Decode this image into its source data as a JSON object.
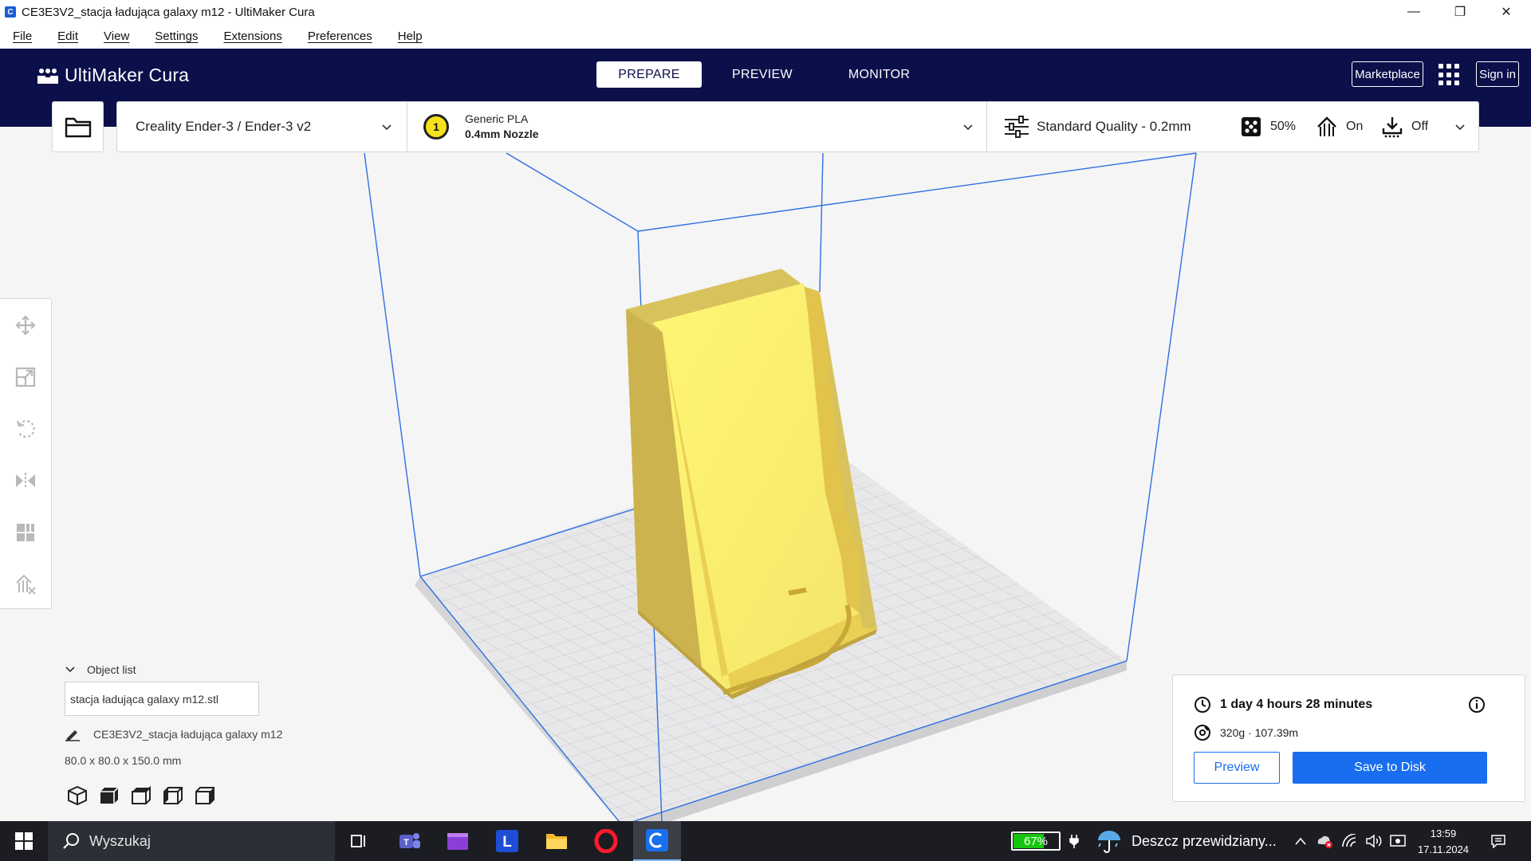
{
  "window": {
    "title": "CE3E3V2_stacja ładująca galaxy m12 - UltiMaker Cura",
    "minimize": "—",
    "restore": "❐",
    "close": "✕"
  },
  "menu": [
    "File",
    "Edit",
    "View",
    "Settings",
    "Extensions",
    "Preferences",
    "Help"
  ],
  "header": {
    "logo_text": "UltiMaker Cura",
    "tabs": [
      {
        "label": "PREPARE",
        "active": true
      },
      {
        "label": "PREVIEW",
        "active": false
      },
      {
        "label": "MONITOR",
        "active": false
      }
    ],
    "marketplace": "Marketplace",
    "signin": "Sign in"
  },
  "toolbar": {
    "printer": "Creality Ender-3 / Ender-3 v2",
    "extruder_number": "1",
    "material": "Generic PLA",
    "nozzle": "0.4mm Nozzle",
    "profile": "Standard Quality - 0.2mm",
    "infill": "50%",
    "support": "On",
    "adhesion": "Off"
  },
  "tools": [
    "move-tool",
    "scale-tool",
    "rotate-tool",
    "mirror-tool",
    "per-model-settings-tool",
    "support-blocker-tool"
  ],
  "object_list": {
    "header": "Object list",
    "items": [
      "stacja ładująca galaxy m12.stl"
    ],
    "job_name": "CE3E3V2_stacja ładująca galaxy m12",
    "dimensions": "80.0 x 80.0 x 150.0 mm"
  },
  "summary": {
    "time": "1 day 4 hours 28 minutes",
    "material": "320g · 107.39m",
    "preview_label": "Preview",
    "save_label": "Save to Disk"
  },
  "taskbar": {
    "search_placeholder": "Wyszukaj",
    "battery": "67%",
    "battery_level": 0.67,
    "weather": "Deszcz przewidziany...",
    "time": "13:59",
    "date": "17.11.2024"
  },
  "colors": {
    "header_bg": "#0b0f4a",
    "accent": "#196ef0",
    "model": "#f7e65a",
    "build_volume": "#2f6fe0"
  }
}
